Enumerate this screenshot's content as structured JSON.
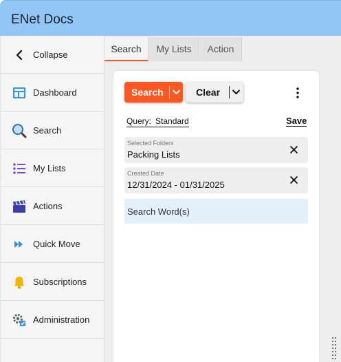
{
  "app": {
    "title": "ENet Docs"
  },
  "sidebar": {
    "items": [
      {
        "label": "Collapse",
        "icon": "chevron-left-icon"
      },
      {
        "label": "Dashboard",
        "icon": "dashboard-icon"
      },
      {
        "label": "Search",
        "icon": "magnifier-icon"
      },
      {
        "label": "My Lists",
        "icon": "list-icon"
      },
      {
        "label": "Actions",
        "icon": "clapperboard-icon"
      },
      {
        "label": "Quick Move",
        "icon": "fast-forward-icon"
      },
      {
        "label": "Subscriptions",
        "icon": "bell-icon"
      },
      {
        "label": "Administration",
        "icon": "gear-icon"
      }
    ]
  },
  "tabs": [
    {
      "label": "Search",
      "active": true
    },
    {
      "label": "My Lists",
      "active": false
    },
    {
      "label": "Action",
      "active": false
    }
  ],
  "toolbar": {
    "search_label": "Search",
    "clear_label": "Clear"
  },
  "query": {
    "label": "Query:",
    "value": "Standard",
    "save_label": "Save"
  },
  "fields": {
    "folders": {
      "label": "Selected Folders",
      "value": "Packing Lists"
    },
    "date": {
      "label": "Created Date",
      "value": "12/31/2024 - 01/31/2025"
    }
  },
  "search_words": {
    "placeholder": "Search Word(s)"
  },
  "colors": {
    "header": "#92c6f5",
    "accent": "#ff5722",
    "search_words_bg": "#e3f0fc"
  }
}
